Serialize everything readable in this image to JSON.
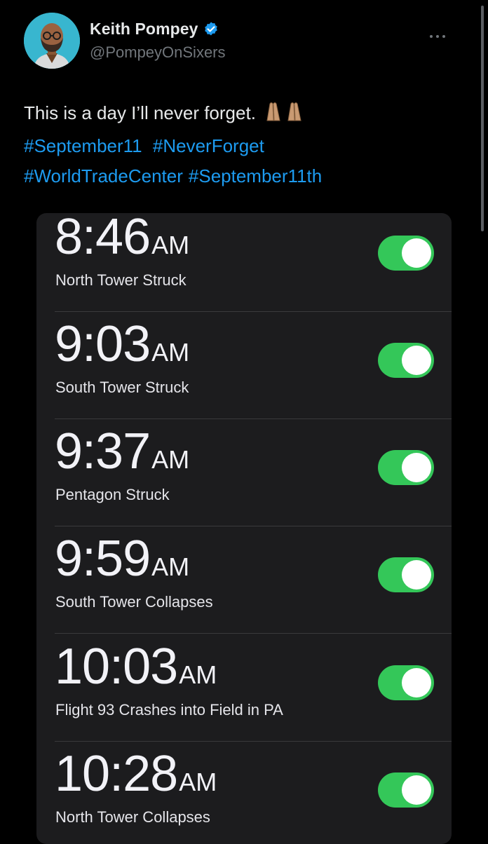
{
  "tweet": {
    "display_name": "Keith Pompey",
    "handle": "@PompeyOnSixers",
    "text": "This is a day I’ll never forget.",
    "hashtags": [
      "#September11",
      "#NeverForget",
      "#WorldTradeCenter",
      "#September11th"
    ]
  },
  "icons": {
    "verified": "verified-badge-icon",
    "more": "more-options-icon",
    "prayer": "folded-hands-emoji"
  },
  "colors": {
    "background": "#000000",
    "link": "#1d9bf0",
    "toggle_on": "#34c759",
    "card": "#1c1c1e"
  },
  "alarms": [
    {
      "time": "8:46",
      "ampm": "AM",
      "label": "North Tower Struck",
      "enabled": true
    },
    {
      "time": "9:03",
      "ampm": "AM",
      "label": "South Tower Struck",
      "enabled": true
    },
    {
      "time": "9:37",
      "ampm": "AM",
      "label": "Pentagon Struck",
      "enabled": true
    },
    {
      "time": "9:59",
      "ampm": "AM",
      "label": "South Tower Collapses",
      "enabled": true
    },
    {
      "time": "10:03",
      "ampm": "AM",
      "label": "Flight 93 Crashes into Field in PA",
      "enabled": true
    },
    {
      "time": "10:28",
      "ampm": "AM",
      "label": "North Tower Collapses",
      "enabled": true
    }
  ]
}
